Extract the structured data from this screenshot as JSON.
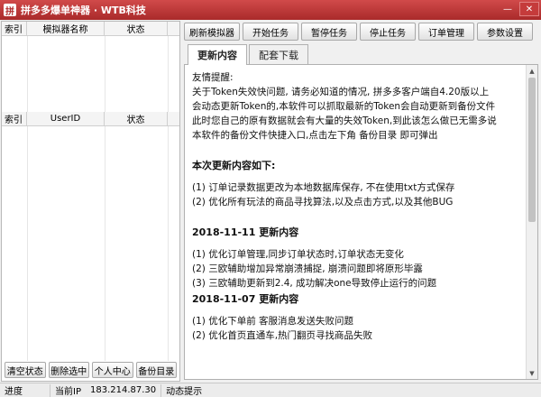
{
  "window": {
    "title": "拼多多爆单神器 · WTB科技",
    "icon_char": "拼"
  },
  "left_grid_top": {
    "headers": [
      "索引",
      "模拟器名称",
      "状态"
    ]
  },
  "left_grid_bottom": {
    "headers": [
      "索引",
      "UserID",
      "状态"
    ]
  },
  "left_buttons": [
    "清空状态",
    "删除选中",
    "个人中心",
    "备份目录"
  ],
  "toolbar": [
    "刷新模拟器",
    "开始任务",
    "暂停任务",
    "停止任务",
    "订单管理",
    "参数设置"
  ],
  "tabs": [
    "更新内容",
    "配套下载"
  ],
  "content": {
    "l1": "友情提醒:",
    "l2": "关于Token失效快问题, 请务必知道的情况, 拼多多客户端自4.20版以上",
    "l3": "会动态更新Token的,本软件可以抓取最新的Token会自动更新到备份文件",
    "l4": "此时您自己的原有数据就会有大量的失效Token,到此该怎么做已无需多说",
    "l5": "本软件的备份文件快捷入口,点击左下角 备份目录 即可弹出",
    "h1": "本次更新内容如下:",
    "l6": "(1) 订单记录数据更改为本地数据库保存, 不在使用txt方式保存",
    "l7": "(2) 优化所有玩法的商品寻找算法,以及点击方式,以及其他BUG",
    "h2": "2018-11-11 更新内容",
    "l8": "(1) 优化订单管理,同步订单状态时,订单状态无变化",
    "l9": "(2) 三欧辅助增加异常崩溃捕捉, 崩溃问题即将原形毕露",
    "l10": "(3) 三欧辅助更新到2.4, 成功解决one导致停止运行的问题",
    "h3": "2018-11-07 更新内容",
    "l11": "(1) 优化下单前 客服消息发送失败问题",
    "l12": "(2) 优化首页直通车,热门翻页寻找商品失败"
  },
  "statusbar": {
    "progress_label": "进度",
    "ip_label": "当前IP",
    "ip_value": "183.214.87.30",
    "hint_label": "动态提示"
  }
}
